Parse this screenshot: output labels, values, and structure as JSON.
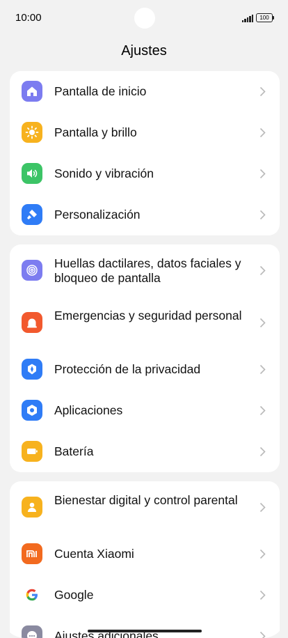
{
  "status_bar": {
    "time": "10:00",
    "battery": "100"
  },
  "header": {
    "title": "Ajustes"
  },
  "groups": [
    {
      "items": [
        {
          "label": "Pantalla de inicio",
          "icon": "home-icon",
          "color": "#7c7cf0"
        },
        {
          "label": "Pantalla y brillo",
          "icon": "sun-icon",
          "color": "#f7b21e"
        },
        {
          "label": "Sonido y vibración",
          "icon": "speaker-icon",
          "color": "#3cc466"
        },
        {
          "label": "Personalización",
          "icon": "brush-icon",
          "color": "#2f7cf6"
        }
      ]
    },
    {
      "items": [
        {
          "label": "Huellas dactilares, datos faciales y bloqueo de pantalla",
          "icon": "fingerprint-icon",
          "color": "#7c7cf0"
        },
        {
          "label": "Emergencias y seguridad personal",
          "icon": "emergency-icon",
          "color": "#f2592e"
        },
        {
          "label": "Protección de la privacidad",
          "icon": "privacy-shield-icon",
          "color": "#2f7cf6"
        },
        {
          "label": "Aplicaciones",
          "icon": "apps-hexagon-icon",
          "color": "#2f7cf6"
        },
        {
          "label": "Batería",
          "icon": "battery-icon",
          "color": "#f7b21e"
        }
      ]
    },
    {
      "items": [
        {
          "label": "Bienestar digital y control parental",
          "icon": "wellbeing-icon",
          "color": "#f7b21e"
        },
        {
          "label": "Cuenta Xiaomi",
          "icon": "xiaomi-icon",
          "color": "#f26a1f"
        },
        {
          "label": "Google",
          "icon": "google-icon",
          "color": "#ffffff"
        },
        {
          "label": "Ajustes adicionales",
          "icon": "more-icon",
          "color": "#8a8aa0"
        }
      ]
    }
  ]
}
